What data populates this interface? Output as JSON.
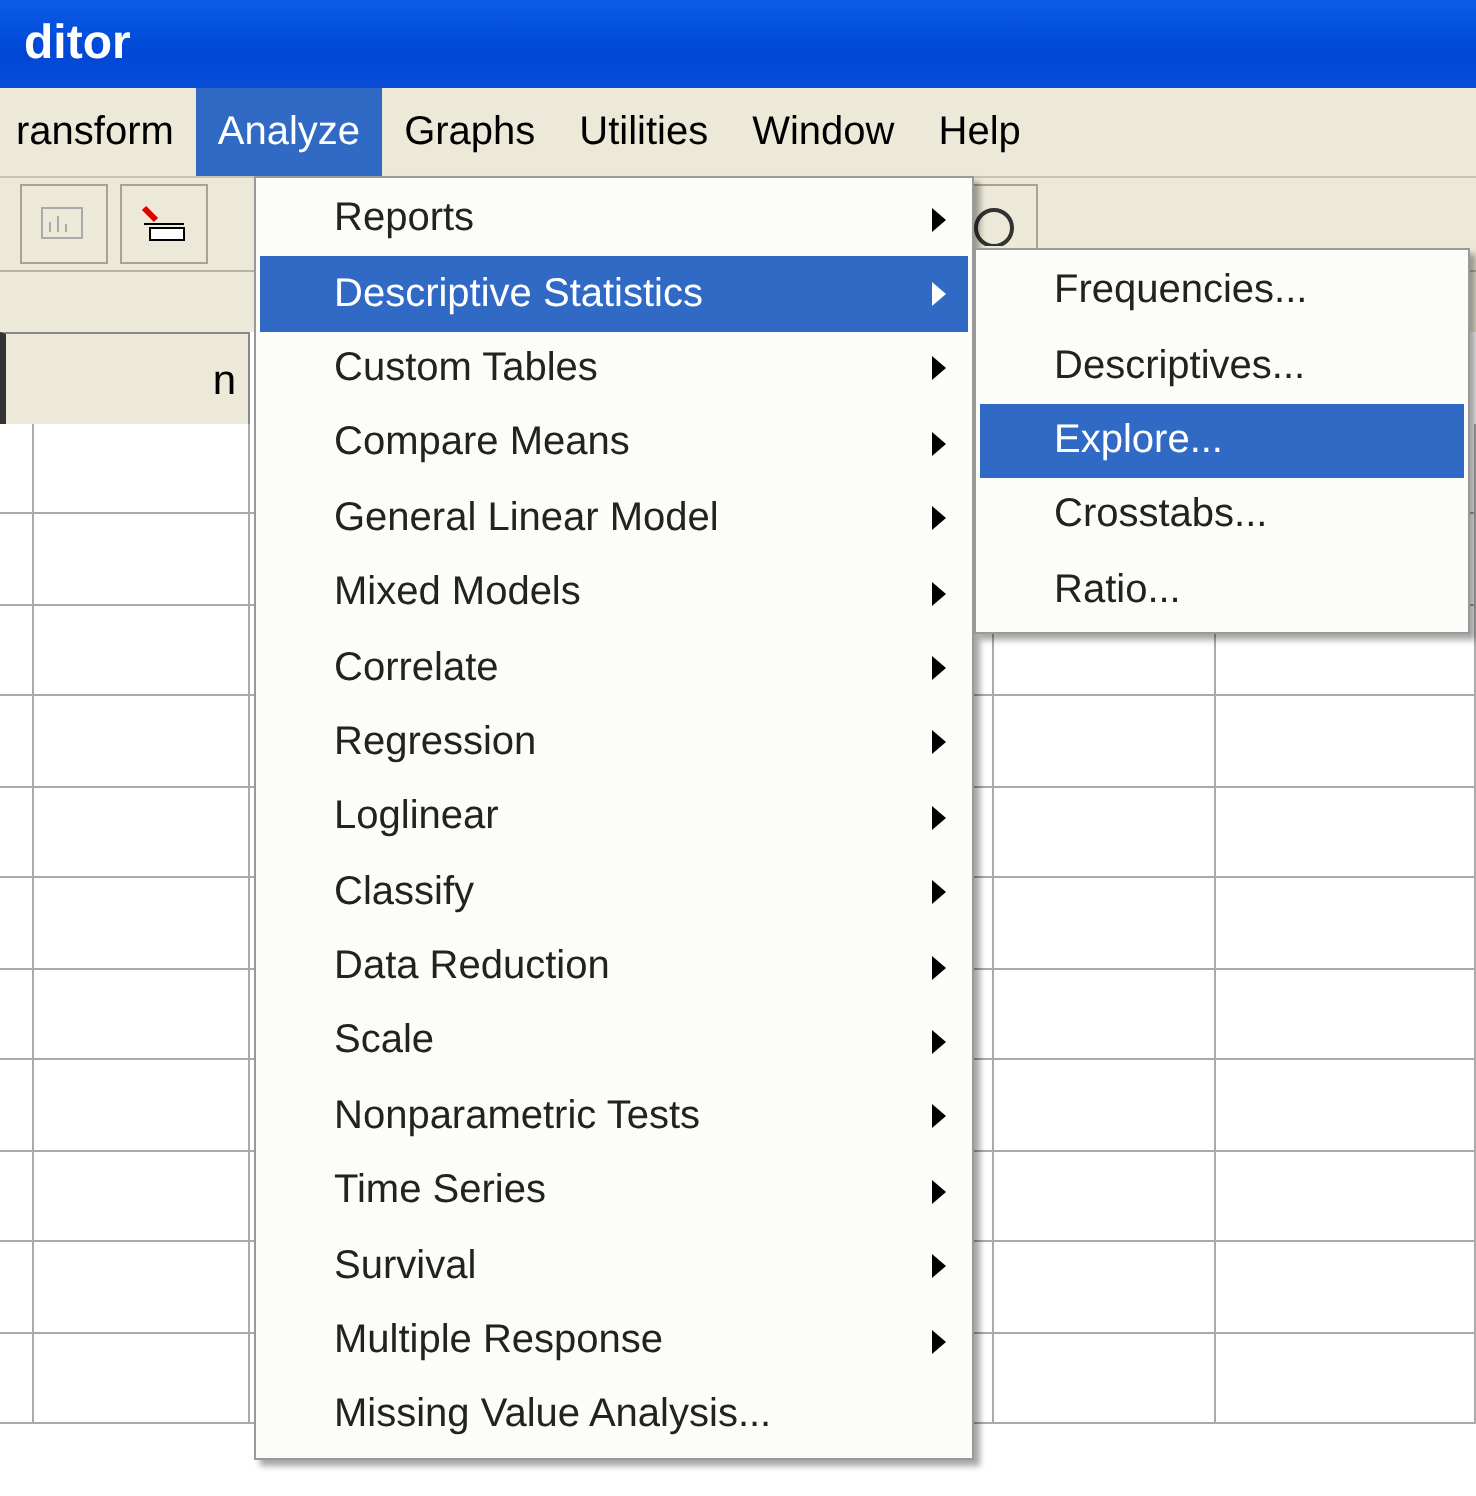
{
  "window": {
    "title": "ditor"
  },
  "menubar": [
    {
      "label": "ransform",
      "selected": false
    },
    {
      "label": "Analyze",
      "selected": true
    },
    {
      "label": "Graphs",
      "selected": false
    },
    {
      "label": "Utilities",
      "selected": false
    },
    {
      "label": "Window",
      "selected": false
    },
    {
      "label": "Help",
      "selected": false
    }
  ],
  "grid": {
    "columns": [
      {
        "label": "n"
      }
    ]
  },
  "analyze_menu": [
    {
      "label": "Reports",
      "kind": "submenu",
      "selected": false
    },
    {
      "label": "Descriptive Statistics",
      "kind": "submenu",
      "selected": true
    },
    {
      "label": "Custom Tables",
      "kind": "submenu",
      "selected": false
    },
    {
      "label": "Compare Means",
      "kind": "submenu",
      "selected": false
    },
    {
      "label": "General Linear Model",
      "kind": "submenu",
      "selected": false
    },
    {
      "label": "Mixed Models",
      "kind": "submenu",
      "selected": false
    },
    {
      "label": "Correlate",
      "kind": "submenu",
      "selected": false
    },
    {
      "label": "Regression",
      "kind": "submenu",
      "selected": false
    },
    {
      "label": "Loglinear",
      "kind": "submenu",
      "selected": false
    },
    {
      "label": "Classify",
      "kind": "submenu",
      "selected": false
    },
    {
      "label": "Data Reduction",
      "kind": "submenu",
      "selected": false
    },
    {
      "label": "Scale",
      "kind": "submenu",
      "selected": false
    },
    {
      "label": "Nonparametric Tests",
      "kind": "submenu",
      "selected": false
    },
    {
      "label": "Time Series",
      "kind": "submenu",
      "selected": false
    },
    {
      "label": "Survival",
      "kind": "submenu",
      "selected": false
    },
    {
      "label": "Multiple Response",
      "kind": "submenu",
      "selected": false
    },
    {
      "label": "Missing Value Analysis...",
      "kind": "command",
      "selected": false
    }
  ],
  "descriptive_submenu": [
    {
      "label": "Frequencies...",
      "selected": false
    },
    {
      "label": "Descriptives...",
      "selected": false
    },
    {
      "label": "Explore...",
      "selected": true
    },
    {
      "label": "Crosstabs...",
      "selected": false
    },
    {
      "label": "Ratio...",
      "selected": false
    }
  ]
}
